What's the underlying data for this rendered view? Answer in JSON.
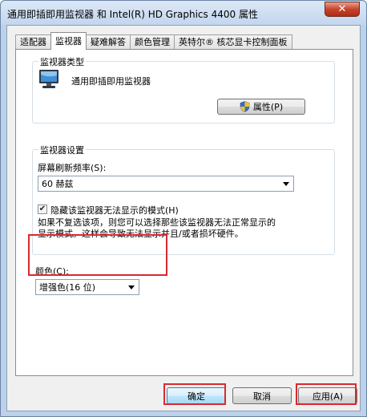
{
  "window": {
    "title": "通用即插即用监视器 和 Intel(R) HD Graphics 4400 属性",
    "close_symbol": "✕"
  },
  "tabs": [
    {
      "label": "适配器",
      "active": false
    },
    {
      "label": "监视器",
      "active": true
    },
    {
      "label": "疑难解答",
      "active": false
    },
    {
      "label": "颜色管理",
      "active": false
    },
    {
      "label": "英特尔® 核芯显卡控制面板",
      "active": false
    }
  ],
  "monitor_type": {
    "group_label": "监视器类型",
    "monitor_name": "通用即插即用监视器",
    "properties_button": "属性(P)",
    "icon": "monitor-icon",
    "shield_icon": "uac-shield-icon"
  },
  "monitor_settings": {
    "group_label": "监视器设置",
    "refresh_label": "屏幕刷新频率(S):",
    "refresh_value": "60 赫兹",
    "hide_modes_checkbox_label": "隐藏该监视器无法显示的模式(H)",
    "hide_modes_checked": true,
    "warning_line1": "如果不复选该项，则您可以选择那些该监视器无法正常显示的",
    "warning_line2": "显示模式。这样会导致无法显示并且/或者损坏硬件。"
  },
  "colors": {
    "label": "颜色(C):",
    "value": "增强色(16 位)"
  },
  "buttons": {
    "ok": "确定",
    "cancel": "取消",
    "apply": "应用(A)"
  },
  "annotations": {
    "highlight_color": "#d9292f"
  }
}
